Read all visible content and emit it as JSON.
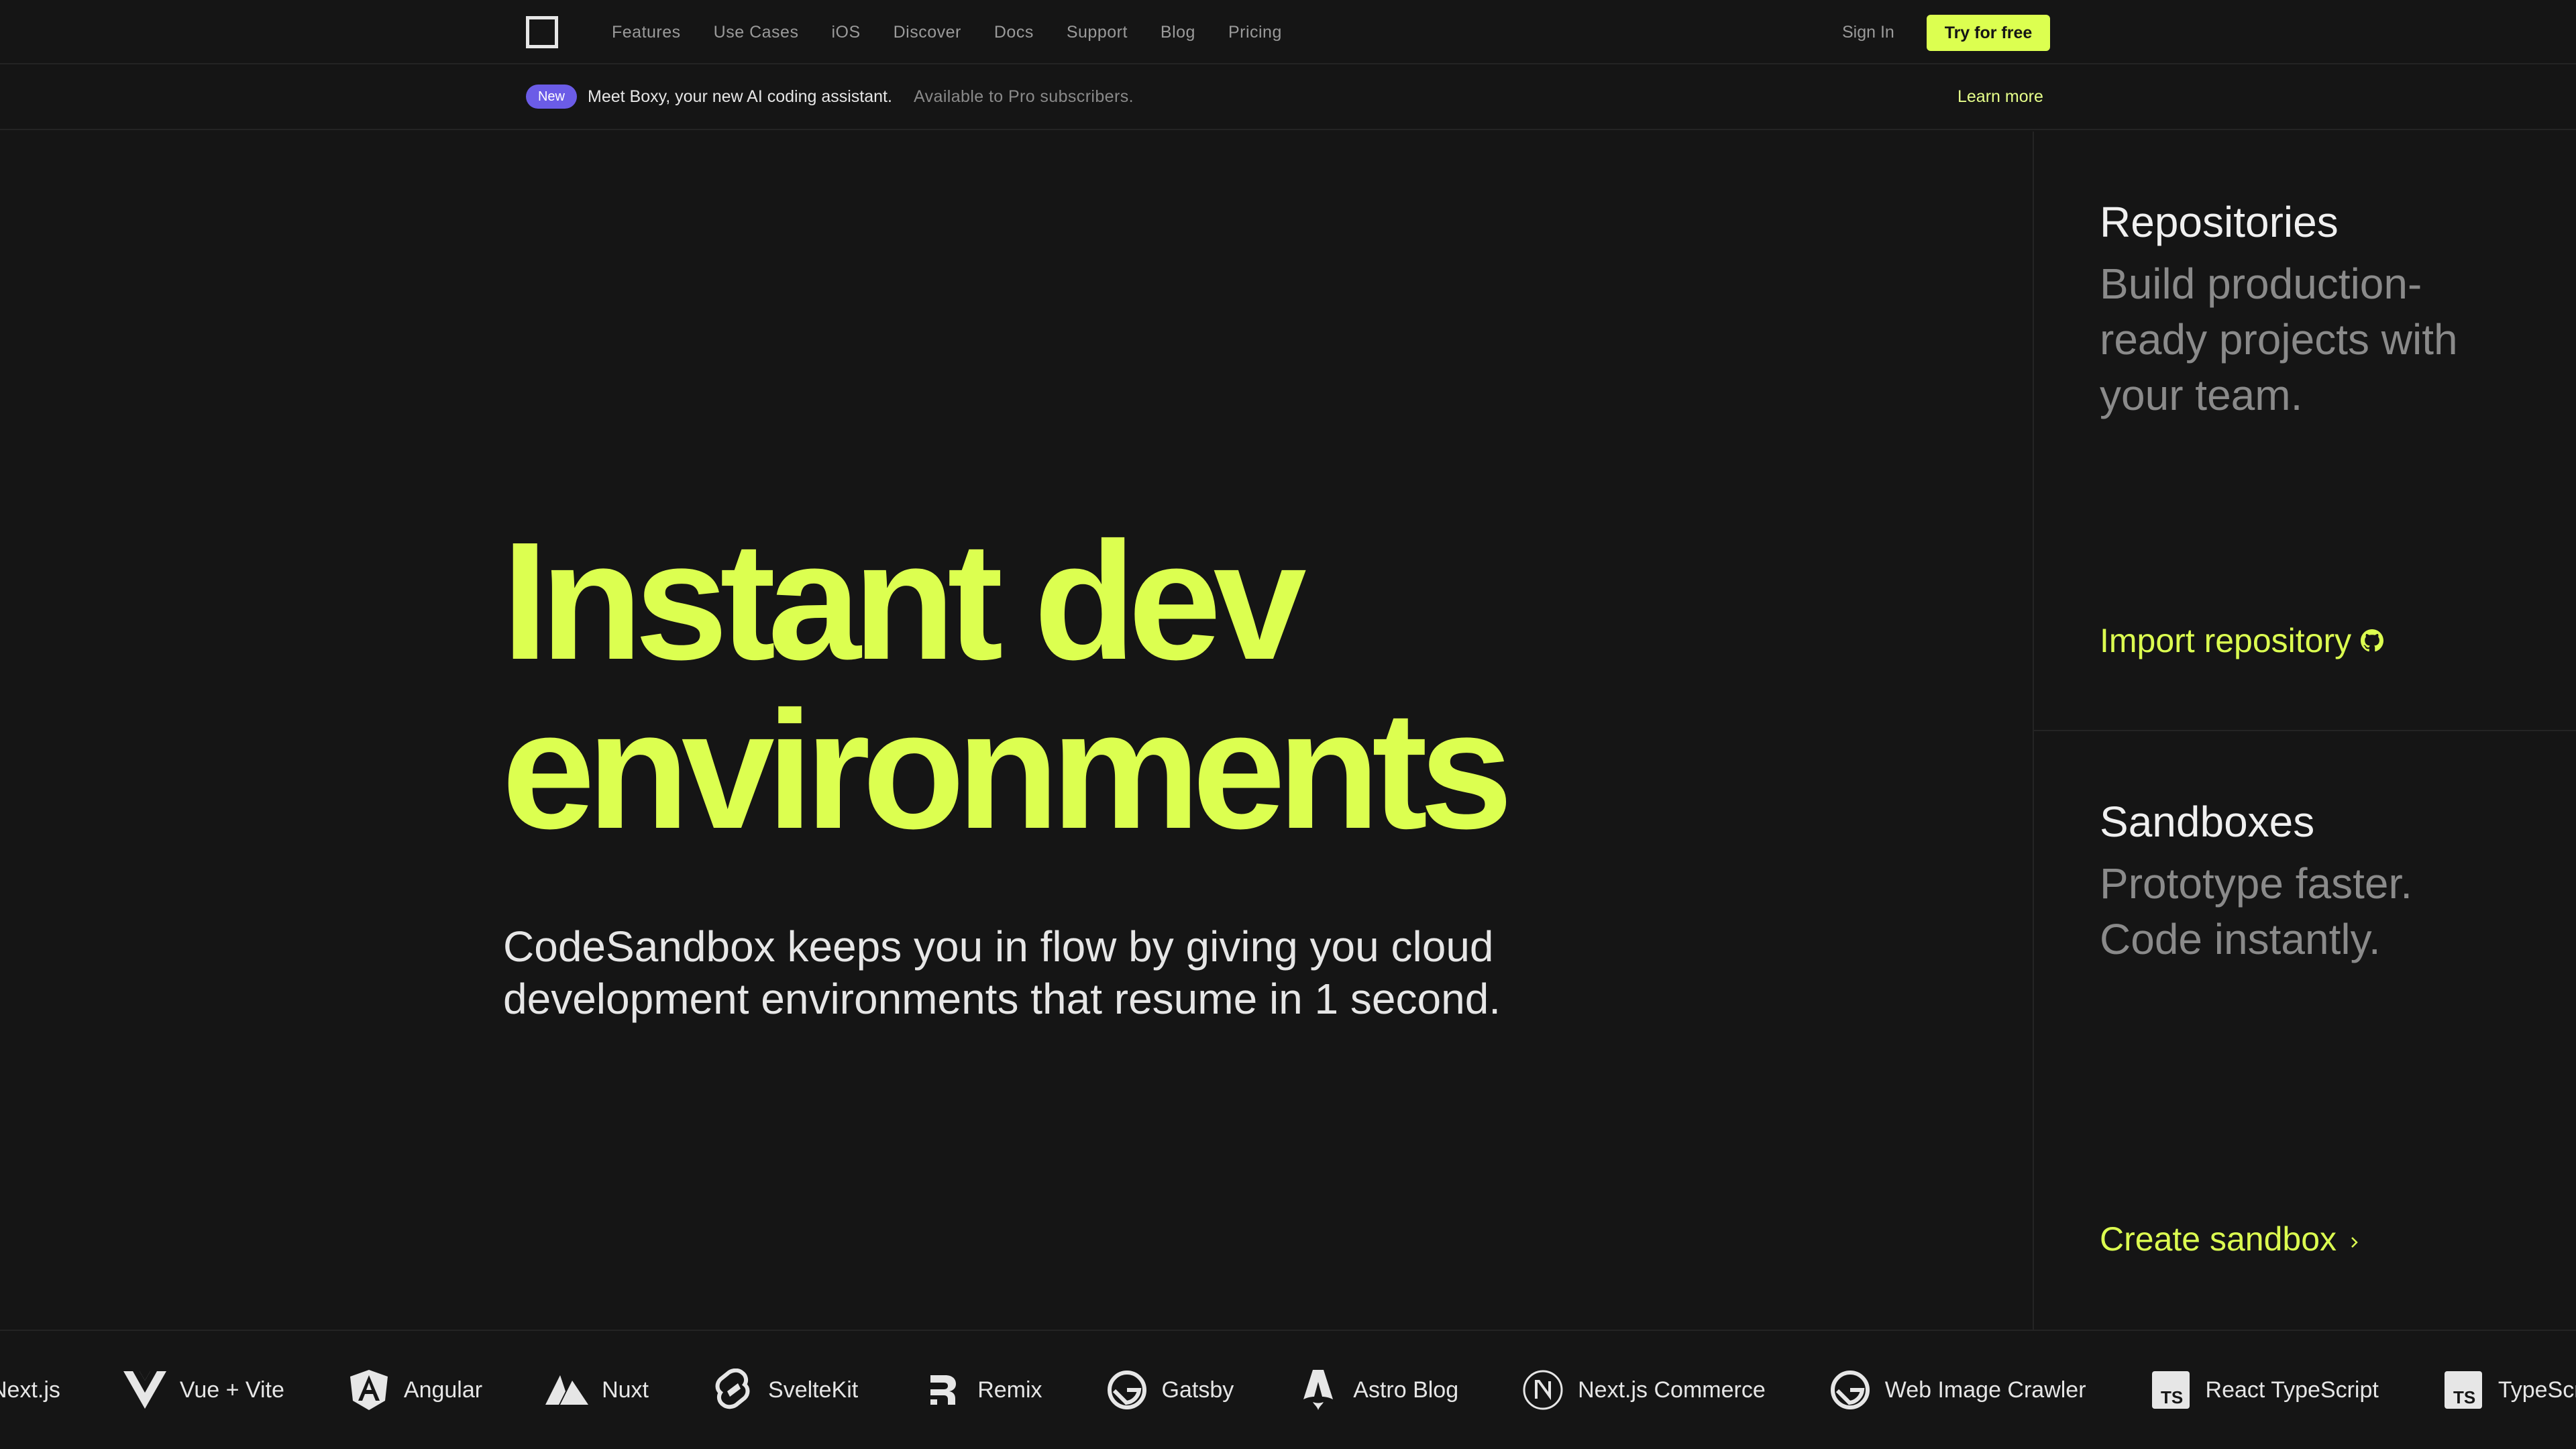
{
  "nav": {
    "logo_icon": "square-logo-icon",
    "links": [
      "Features",
      "Use Cases",
      "iOS",
      "Discover",
      "Docs",
      "Support",
      "Blog",
      "Pricing"
    ],
    "sign_in": "Sign In",
    "cta": "Try for free"
  },
  "banner": {
    "badge": "New",
    "message": "Meet Boxy, your new AI coding assistant.",
    "sub": "Available to Pro subscribers.",
    "learn_more": "Learn more"
  },
  "hero": {
    "title_line1": "Instant dev",
    "title_line2": "environments",
    "subtitle_line1": "CodeSandbox keeps you in flow by giving you cloud",
    "subtitle_line2": "development environments that resume in 1 second."
  },
  "cards": [
    {
      "title": "Repositories",
      "description": "Build production-ready projects with your team.",
      "cta": "Import repository",
      "cta_icon": "github-icon"
    },
    {
      "title": "Sandboxes",
      "description": "Prototype faster. Code instantly.",
      "cta": "Create sandbox",
      "cta_icon": "chevron-right-icon"
    }
  ],
  "frameworks": [
    {
      "label": "Next.js",
      "icon": "nextjs-icon"
    },
    {
      "label": "Vue + Vite",
      "icon": "vue-icon"
    },
    {
      "label": "Angular",
      "icon": "angular-icon"
    },
    {
      "label": "Nuxt",
      "icon": "nuxt-icon"
    },
    {
      "label": "SvelteKit",
      "icon": "svelte-icon"
    },
    {
      "label": "Remix",
      "icon": "remix-icon"
    },
    {
      "label": "Gatsby",
      "icon": "gatsby-icon"
    },
    {
      "label": "Astro Blog",
      "icon": "astro-icon"
    },
    {
      "label": "Next.js Commerce",
      "icon": "nextjs-icon"
    },
    {
      "label": "Web Image Crawler",
      "icon": "gatsby-icon"
    },
    {
      "label": "React TypeScript",
      "icon": "typescript-icon"
    },
    {
      "label": "TypeScript",
      "icon": "typescript-icon"
    }
  ],
  "colors": {
    "background": "#151515",
    "accent": "#dcff50",
    "badge": "#6b5ce7"
  }
}
